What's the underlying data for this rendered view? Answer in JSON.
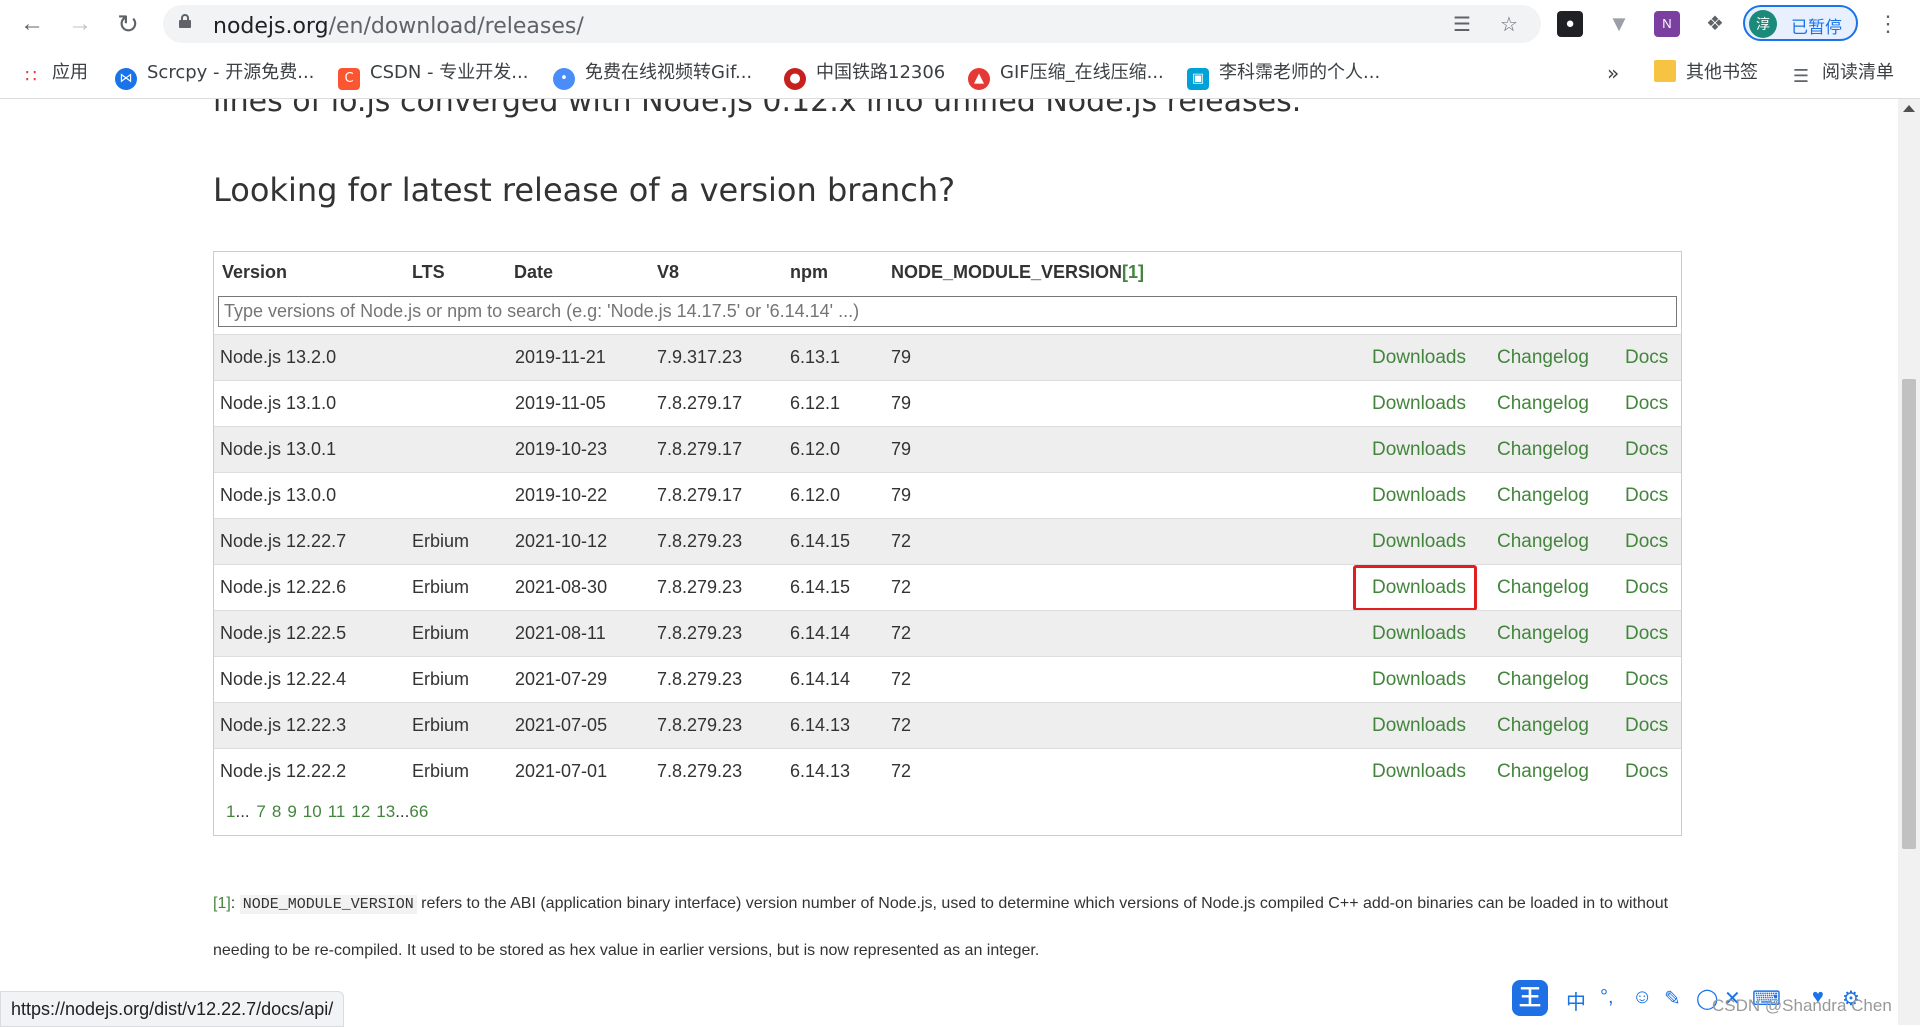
{
  "browser": {
    "url_host": "nodejs.org",
    "url_path": "/en/download/releases/",
    "profile_initial": "淳",
    "profile_status": "已暂停"
  },
  "bookmarks": {
    "apps": "应用",
    "items": [
      {
        "label": "Scrcpy - 开源免费...",
        "color": "#1a73e8"
      },
      {
        "label": "CSDN - 专业开发...",
        "color": "#fc5531"
      },
      {
        "label": "免费在线视频转Gif...",
        "color": "#4b8df8"
      },
      {
        "label": "中国铁路12306",
        "color": "#c5221f"
      },
      {
        "label": "GIF压缩_在线压缩...",
        "color": "#e53935"
      },
      {
        "label": "李科霈老师的个人...",
        "color": "#00a1d6"
      }
    ],
    "more": "»",
    "other": "其他书签",
    "reading_list": "阅读清单"
  },
  "page": {
    "intro": "lines of io.js converged with Node.js 0.12.x into unified Node.js releases.",
    "heading": "Looking for latest release of a version branch?"
  },
  "table": {
    "headers": {
      "version": "Version",
      "lts": "LTS",
      "date": "Date",
      "v8": "V8",
      "npm": "npm",
      "module": "NODE_MODULE_VERSION",
      "module_ref": "[1]"
    },
    "search_placeholder": "Type versions of Node.js or npm to search (e.g: 'Node.js 14.17.5' or '6.14.14' ...)",
    "link_labels": {
      "downloads": "Downloads",
      "changelog": "Changelog",
      "docs": "Docs"
    },
    "rows": [
      {
        "version": "Node.js 13.2.0",
        "lts": "",
        "date": "2019-11-21",
        "v8": "7.9.317.23",
        "npm": "6.13.1",
        "module": "79"
      },
      {
        "version": "Node.js 13.1.0",
        "lts": "",
        "date": "2019-11-05",
        "v8": "7.8.279.17",
        "npm": "6.12.1",
        "module": "79"
      },
      {
        "version": "Node.js 13.0.1",
        "lts": "",
        "date": "2019-10-23",
        "v8": "7.8.279.17",
        "npm": "6.12.0",
        "module": "79"
      },
      {
        "version": "Node.js 13.0.0",
        "lts": "",
        "date": "2019-10-22",
        "v8": "7.8.279.17",
        "npm": "6.12.0",
        "module": "79"
      },
      {
        "version": "Node.js 12.22.7",
        "lts": "Erbium",
        "date": "2021-10-12",
        "v8": "7.8.279.23",
        "npm": "6.14.15",
        "module": "72"
      },
      {
        "version": "Node.js 12.22.6",
        "lts": "Erbium",
        "date": "2021-08-30",
        "v8": "7.8.279.23",
        "npm": "6.14.15",
        "module": "72"
      },
      {
        "version": "Node.js 12.22.5",
        "lts": "Erbium",
        "date": "2021-08-11",
        "v8": "7.8.279.23",
        "npm": "6.14.14",
        "module": "72"
      },
      {
        "version": "Node.js 12.22.4",
        "lts": "Erbium",
        "date": "2021-07-29",
        "v8": "7.8.279.23",
        "npm": "6.14.14",
        "module": "72"
      },
      {
        "version": "Node.js 12.22.3",
        "lts": "Erbium",
        "date": "2021-07-05",
        "v8": "7.8.279.23",
        "npm": "6.14.13",
        "module": "72"
      },
      {
        "version": "Node.js 12.22.2",
        "lts": "Erbium",
        "date": "2021-07-01",
        "v8": "7.8.279.23",
        "npm": "6.14.13",
        "module": "72"
      }
    ],
    "highlighted_row": 5,
    "pagination": [
      "1",
      "...",
      "7",
      "8",
      "9",
      "10",
      "11",
      "12",
      "13",
      "...",
      "66"
    ]
  },
  "footnote": {
    "ref": "[1]",
    "code": "NODE_MODULE_VERSION",
    "text": "refers to the ABI (application binary interface) version number of Node.js, used to determine which versions of Node.js compiled C++ add-on binaries can be loaded in to without needing to be re-compiled. It used to be stored as hex value in earlier versions, but is now represented as an integer."
  },
  "status_bar": "https://nodejs.org/dist/v12.22.7/docs/api/",
  "ime": {
    "logo": "王",
    "mode": "中",
    "watermark": "CSDN @Shandra Chen"
  },
  "colors": {
    "link_green": "#43853d",
    "highlight_red": "#e02020"
  }
}
